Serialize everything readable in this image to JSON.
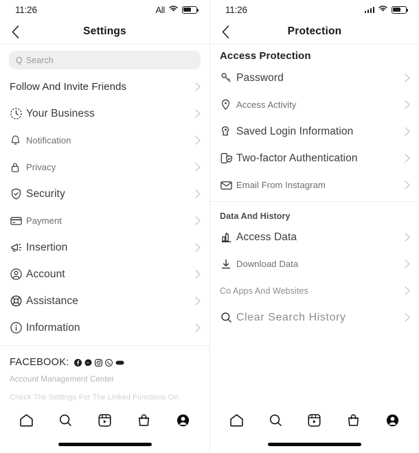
{
  "left": {
    "status": {
      "time": "11:26",
      "carrier": "All",
      "signal_icon": "carrier-text",
      "wifi_icon": "wifi-icon",
      "battery_icon": "battery-icon"
    },
    "nav": {
      "back_icon": "back-chevron-icon",
      "title": "Settings"
    },
    "search": {
      "placeholder": "Search",
      "icon": "search-icon",
      "query_glyph": "Q"
    },
    "items": [
      {
        "label": "Follow And Invite Friends",
        "icon": "none",
        "style": "plain-dark"
      },
      {
        "label": "Your Business",
        "icon": "clock-icon",
        "style": "big"
      },
      {
        "label": "Notification",
        "icon": "bell-icon",
        "style": "small"
      },
      {
        "label": "Privacy",
        "icon": "lock-icon",
        "style": "small"
      },
      {
        "label": "Security",
        "icon": "shield-check-icon",
        "style": "big"
      },
      {
        "label": "Payment",
        "icon": "card-icon",
        "style": "small"
      },
      {
        "label": "Insertion",
        "icon": "megaphone-icon",
        "style": "big"
      },
      {
        "label": "Account",
        "icon": "account-circle-icon",
        "style": "big"
      },
      {
        "label": "Assistance",
        "icon": "lifebuoy-icon",
        "style": "big"
      },
      {
        "label": "Information",
        "icon": "info-circle-icon",
        "style": "big"
      }
    ],
    "footer": {
      "brand": "FACEBOOK:",
      "social_icons": [
        "facebook-icon",
        "messenger-icon",
        "instagram-icon",
        "whatsapp-icon",
        "meta-icon"
      ],
      "line1": "Account Management Center",
      "line2": "Check The Settings For The Linked Functions On"
    }
  },
  "right": {
    "status": {
      "time": "11:26",
      "signal_icon": "signal-bars-icon",
      "wifi_icon": "wifi-icon",
      "battery_icon": "battery-icon"
    },
    "nav": {
      "back_icon": "back-chevron-icon",
      "title": "Protection"
    },
    "section1": {
      "title": "Access Protection"
    },
    "items1": [
      {
        "label": "Password",
        "icon": "key-icon",
        "style": "big"
      },
      {
        "label": "Access Activity",
        "icon": "location-pin-icon",
        "style": "small"
      },
      {
        "label": "Saved Login Information",
        "icon": "keyhole-icon",
        "style": "big"
      },
      {
        "label": "Two-factor Authentication",
        "icon": "phone-shield-icon",
        "style": "big"
      },
      {
        "label": "Email From Instagram",
        "icon": "envelope-icon",
        "style": "small"
      }
    ],
    "section2": {
      "title": "Data And History"
    },
    "items2": [
      {
        "label": "Access Data",
        "icon": "bar-chart-icon",
        "style": "big"
      },
      {
        "label": "Download Data",
        "icon": "download-icon",
        "style": "small"
      },
      {
        "label": "Co Apps And Websites",
        "icon": "none",
        "style": "faint"
      },
      {
        "label": "Clear Search History",
        "icon": "search-icon",
        "style": "big"
      }
    ]
  },
  "tabbar": {
    "tabs": [
      {
        "name": "home-tab",
        "icon": "home-icon"
      },
      {
        "name": "search-tab",
        "icon": "search-icon"
      },
      {
        "name": "reels-tab",
        "icon": "reels-icon"
      },
      {
        "name": "shop-tab",
        "icon": "shop-bag-icon"
      },
      {
        "name": "profile-tab",
        "icon": "profile-avatar-icon"
      }
    ]
  },
  "colors": {
    "text_dark": "#2b2b2b",
    "text_muted": "#8e8e8e",
    "divider": "#ededed",
    "search_bg": "#efefef"
  }
}
